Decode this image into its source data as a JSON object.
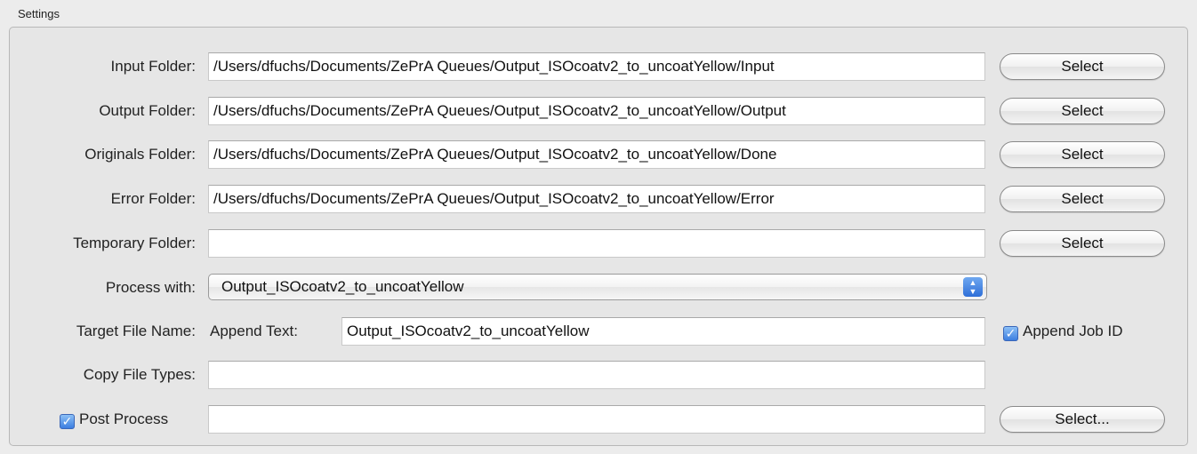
{
  "settings": {
    "title": "Settings",
    "input_folder": {
      "label": "Input Folder:",
      "value": "/Users/dfuchs/Documents/ZePrA Queues/Output_ISOcoatv2_to_uncoatYellow/Input",
      "button": "Select"
    },
    "output_folder": {
      "label": "Output Folder:",
      "value": "/Users/dfuchs/Documents/ZePrA Queues/Output_ISOcoatv2_to_uncoatYellow/Output",
      "button": "Select"
    },
    "originals_folder": {
      "label": "Originals Folder:",
      "value": "/Users/dfuchs/Documents/ZePrA Queues/Output_ISOcoatv2_to_uncoatYellow/Done",
      "button": "Select"
    },
    "error_folder": {
      "label": "Error Folder:",
      "value": "/Users/dfuchs/Documents/ZePrA Queues/Output_ISOcoatv2_to_uncoatYellow/Error",
      "button": "Select"
    },
    "temporary_folder": {
      "label": "Temporary Folder:",
      "value": "",
      "button": "Select"
    },
    "process_with": {
      "label": "Process with:",
      "selected": "Output_ISOcoatv2_to_uncoatYellow"
    },
    "target_file_name": {
      "label": "Target File Name:",
      "append_text_label": "Append Text:",
      "append_text_value": "Output_ISOcoatv2_to_uncoatYellow",
      "append_job_id_label": "Append Job ID",
      "append_job_id_checked": true
    },
    "copy_file_types": {
      "label": "Copy File Types:",
      "value": ""
    },
    "post_process": {
      "label": "Post Process",
      "checked": true,
      "value": "",
      "button": "Select..."
    }
  },
  "colors": {
    "checkbox_accent": "#3c7ee0"
  }
}
